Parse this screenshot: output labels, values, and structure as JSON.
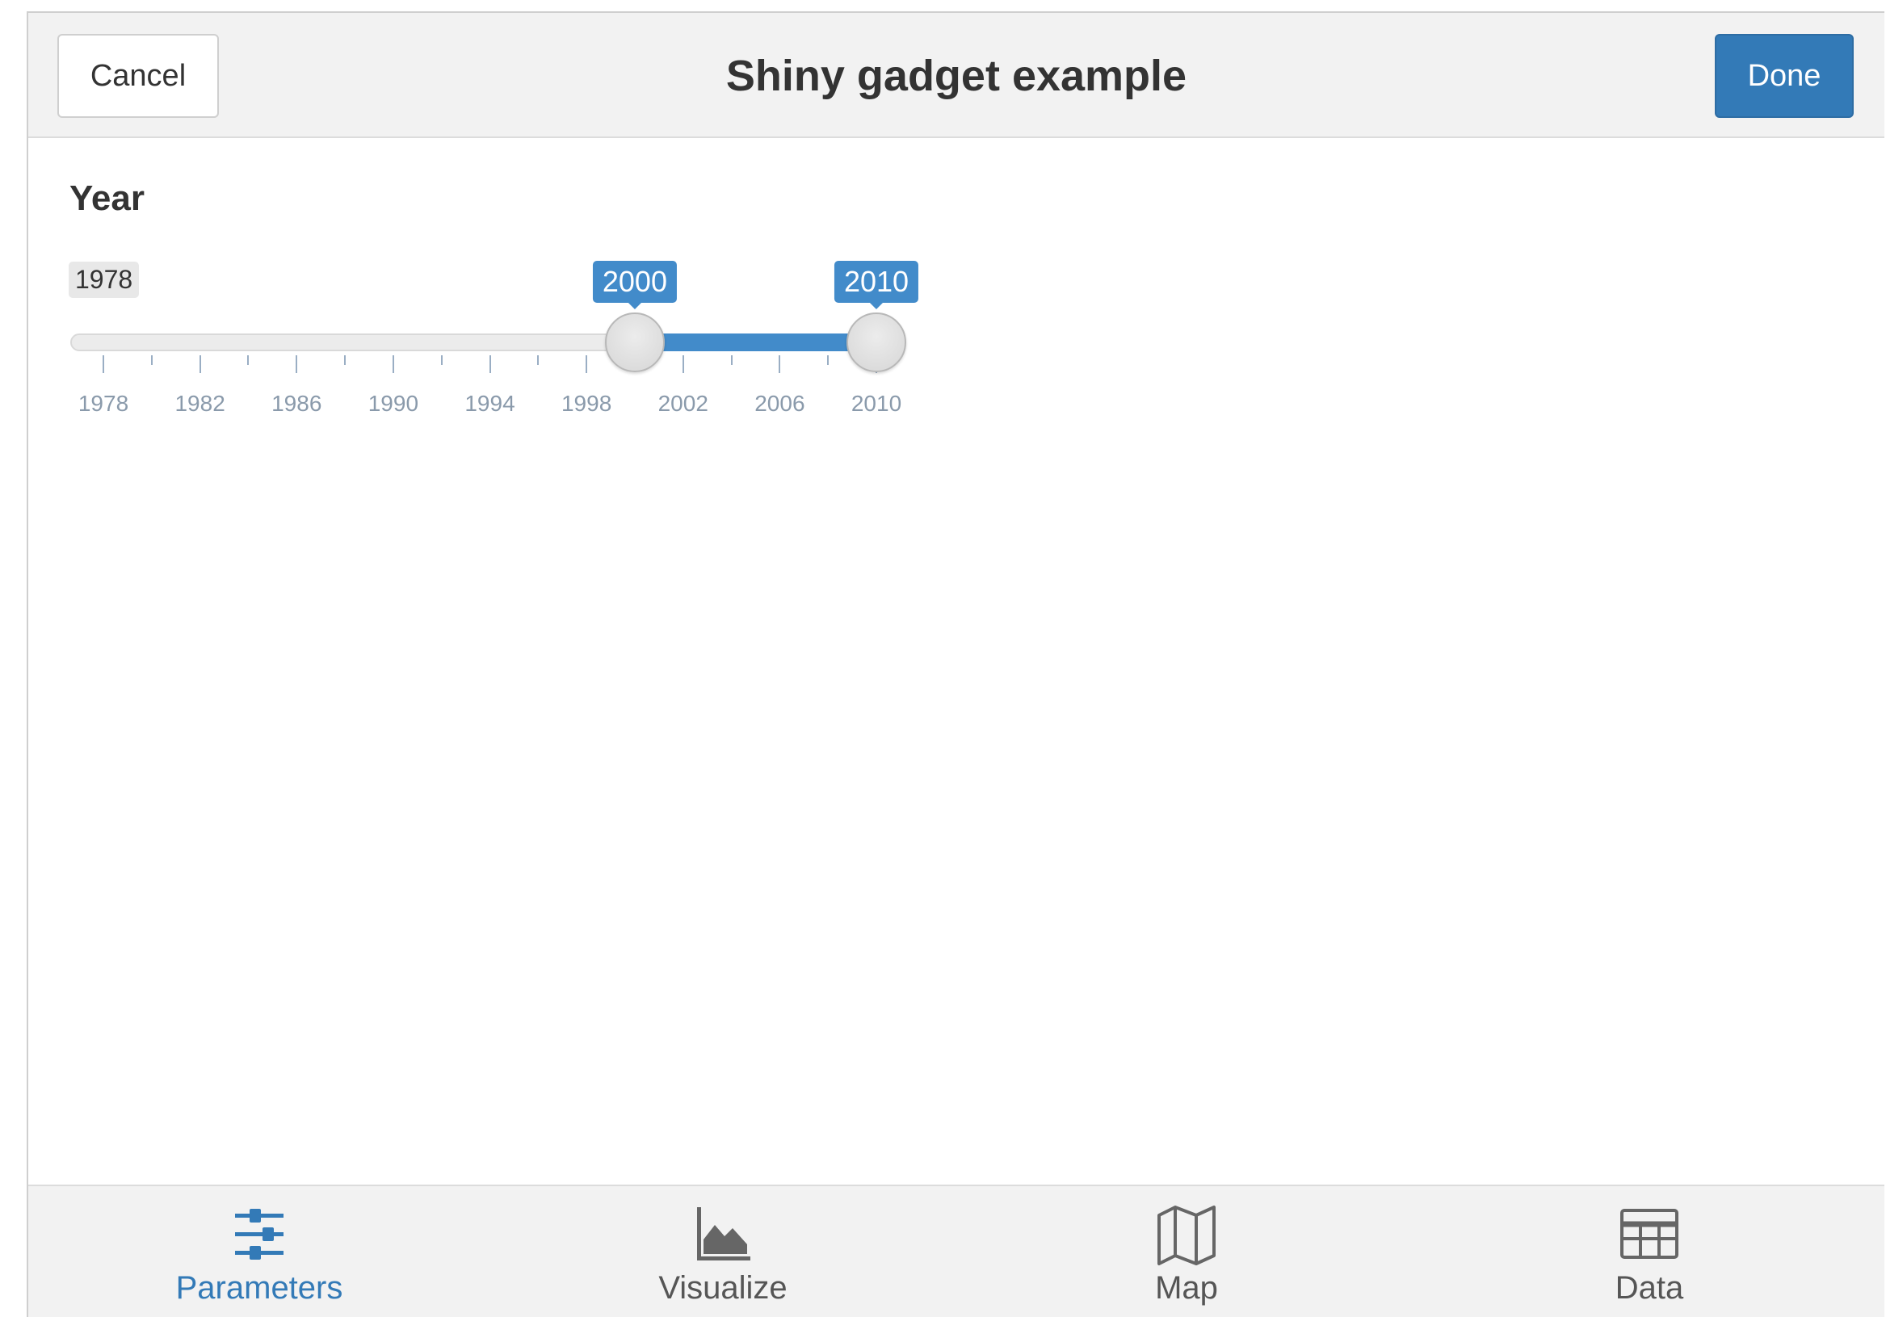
{
  "header": {
    "title": "Shiny gadget example",
    "cancel_label": "Cancel",
    "done_label": "Done"
  },
  "slider": {
    "label": "Year",
    "min": 1978,
    "max": 2010,
    "min_label": "1978",
    "value_low": 2000,
    "value_high": 2010,
    "value_low_label": "2000",
    "value_high_label": "2010",
    "tick_labels": [
      "1978",
      "1982",
      "1986",
      "1990",
      "1994",
      "1998",
      "2002",
      "2006",
      "2010"
    ]
  },
  "tabs": [
    {
      "label": "Parameters",
      "icon": "sliders-icon",
      "active": true
    },
    {
      "label": "Visualize",
      "icon": "area-chart-icon",
      "active": false
    },
    {
      "label": "Map",
      "icon": "map-icon",
      "active": false
    },
    {
      "label": "Data",
      "icon": "table-icon",
      "active": false
    }
  ],
  "colors": {
    "accent": "#337ab7",
    "slider_fill": "#428bca"
  }
}
